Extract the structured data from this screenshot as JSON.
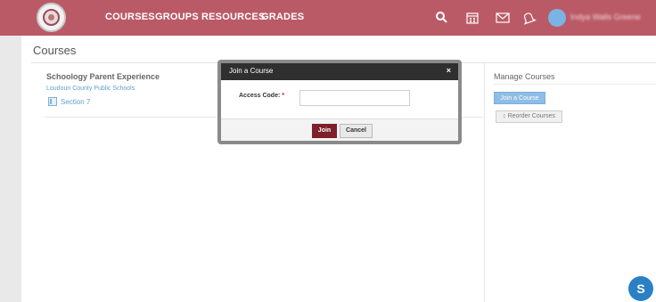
{
  "topbar": {
    "nav": [
      "COURSES",
      "GROUPS",
      "RESOURCES",
      "GRADES"
    ],
    "user_name": "Indya Walls Greene",
    "icons": [
      "search-icon",
      "calendar-icon",
      "mail-icon",
      "bell-icon"
    ],
    "brand_color": "#bb5a67"
  },
  "page": {
    "title": "Courses"
  },
  "course": {
    "name": "Schoology Parent Experience",
    "school": "Loudoun County Public Schools",
    "section": "Section 7"
  },
  "manage": {
    "title": "Manage Courses",
    "join_label": "Join a Course",
    "reorder_label": "Reorder Courses"
  },
  "modal": {
    "title": "Join a Course",
    "close": "×",
    "field_label": "Access Code:",
    "required_mark": "*",
    "input_value": "",
    "join_label": "Join",
    "cancel_label": "Cancel"
  },
  "chat": {
    "label": "S"
  }
}
